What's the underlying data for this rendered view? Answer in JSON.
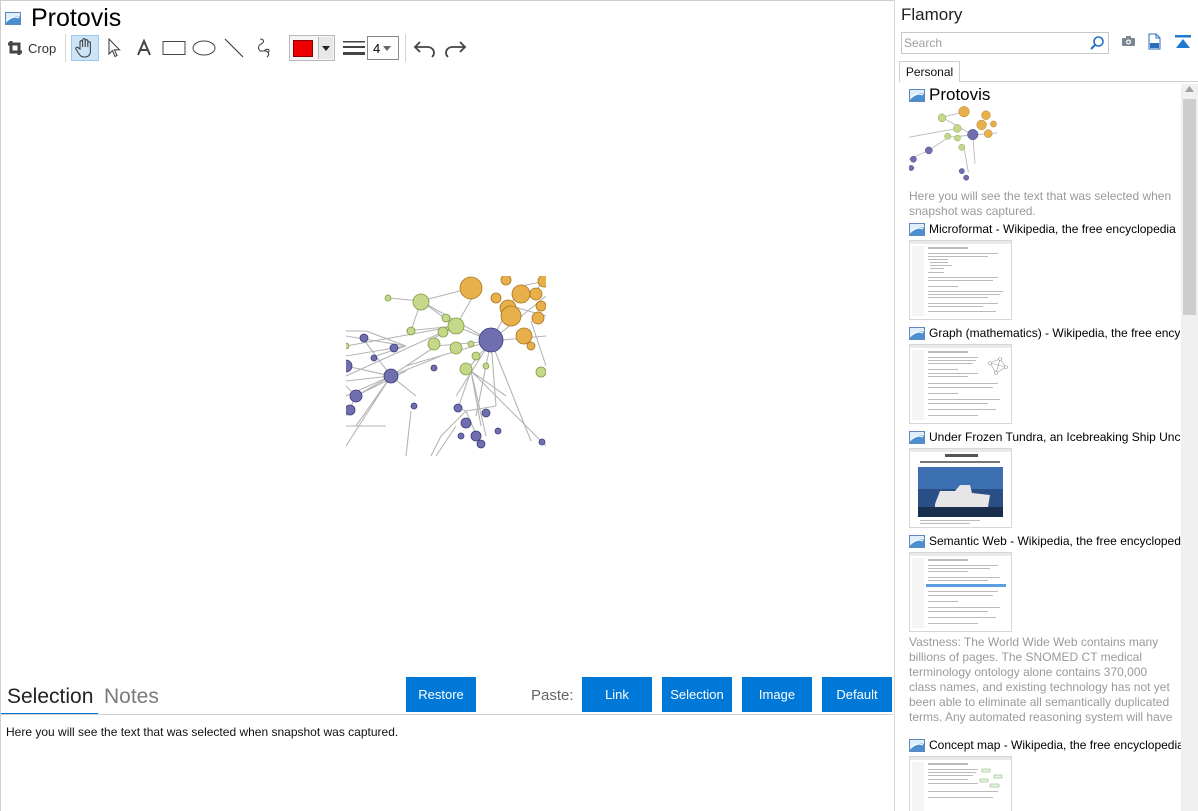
{
  "document": {
    "title": "Protovis"
  },
  "toolbar": {
    "crop_label": "Crop",
    "line_width": "4",
    "stroke_color": "#ee0000",
    "tools": [
      "hand-icon",
      "pointer-icon",
      "text-icon",
      "rectangle-icon",
      "ellipse-icon",
      "line-icon",
      "freehand-icon"
    ]
  },
  "bottom": {
    "tab_selection": "Selection",
    "tab_notes": "Notes",
    "restore_label": "Restore",
    "paste_label": "Paste:",
    "link_label": "Link",
    "selection_label": "Selection",
    "image_label": "Image",
    "default_label": "Default",
    "selected_text": "Here you will see the text that was selected when snapshot was captured."
  },
  "sidebar": {
    "app_title": "Flamory",
    "search_placeholder": "Search",
    "tab_personal": "Personal",
    "entries": [
      {
        "title": "Protovis",
        "desc": "Here you will see the text that was selected when snapshot was captured."
      },
      {
        "title": "Microformat - Wikipedia, the free encyclopedia"
      },
      {
        "title": "Graph (mathematics) - Wikipedia, the free ency"
      },
      {
        "title": "Under Frozen Tundra, an Icebreaking Ship Unco"
      },
      {
        "title": "Semantic Web - Wikipedia, the free encycloped",
        "desc": "Vastness: The World Wide Web contains many billions of pages. The SNOMED CT medical terminology ontology alone contains 370,000 class names, and existing technology has not yet been able to eliminate all semantically duplicated terms. Any automated reasoning system will have to deal with truly huge inputs."
      },
      {
        "title": "Concept map - Wikipedia, the free encyclopedia"
      }
    ]
  },
  "colors": {
    "accent": "#0078d7",
    "hand_tool_active": "#cce4f7",
    "node_purple": "#6f6fb0",
    "node_green": "#c5d88a",
    "node_orange": "#e8b04a"
  }
}
